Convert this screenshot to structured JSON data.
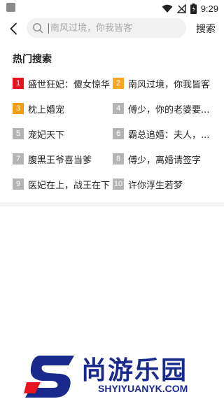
{
  "status_bar": {
    "time": "9:29"
  },
  "search": {
    "placeholder": "南风过境，你我皆客",
    "submit_label": "搜索"
  },
  "hot_search": {
    "title": "热门搜索",
    "items": [
      {
        "rank": "1",
        "label": "盛世狂妃：傻女惊华",
        "color": "#e8141e"
      },
      {
        "rank": "2",
        "label": "南风过境，你我皆客",
        "color": "#f5a623"
      },
      {
        "rank": "3",
        "label": "枕上婚宠",
        "color": "#f39c12"
      },
      {
        "rank": "4",
        "label": "傅少，你的老婆要...",
        "color": "#b4b4b4"
      },
      {
        "rank": "5",
        "label": "宠妃天下",
        "color": "#b4b4b4"
      },
      {
        "rank": "6",
        "label": "霸总追婚：夫人，...",
        "color": "#b4b4b4"
      },
      {
        "rank": "7",
        "label": "腹黑王爷喜当爹",
        "color": "#b4b4b4"
      },
      {
        "rank": "8",
        "label": "傅少，离婚请签字",
        "color": "#b4b4b4"
      },
      {
        "rank": "9",
        "label": "医妃在上，战王在下",
        "color": "#b4b4b4"
      },
      {
        "rank": "10",
        "label": "许你浮生若梦",
        "color": "#b4b4b4"
      }
    ]
  },
  "watermark": {
    "cn": "尚游乐园",
    "en": "SHYIYUANYK.COM",
    "color": "#1a2a8c"
  }
}
